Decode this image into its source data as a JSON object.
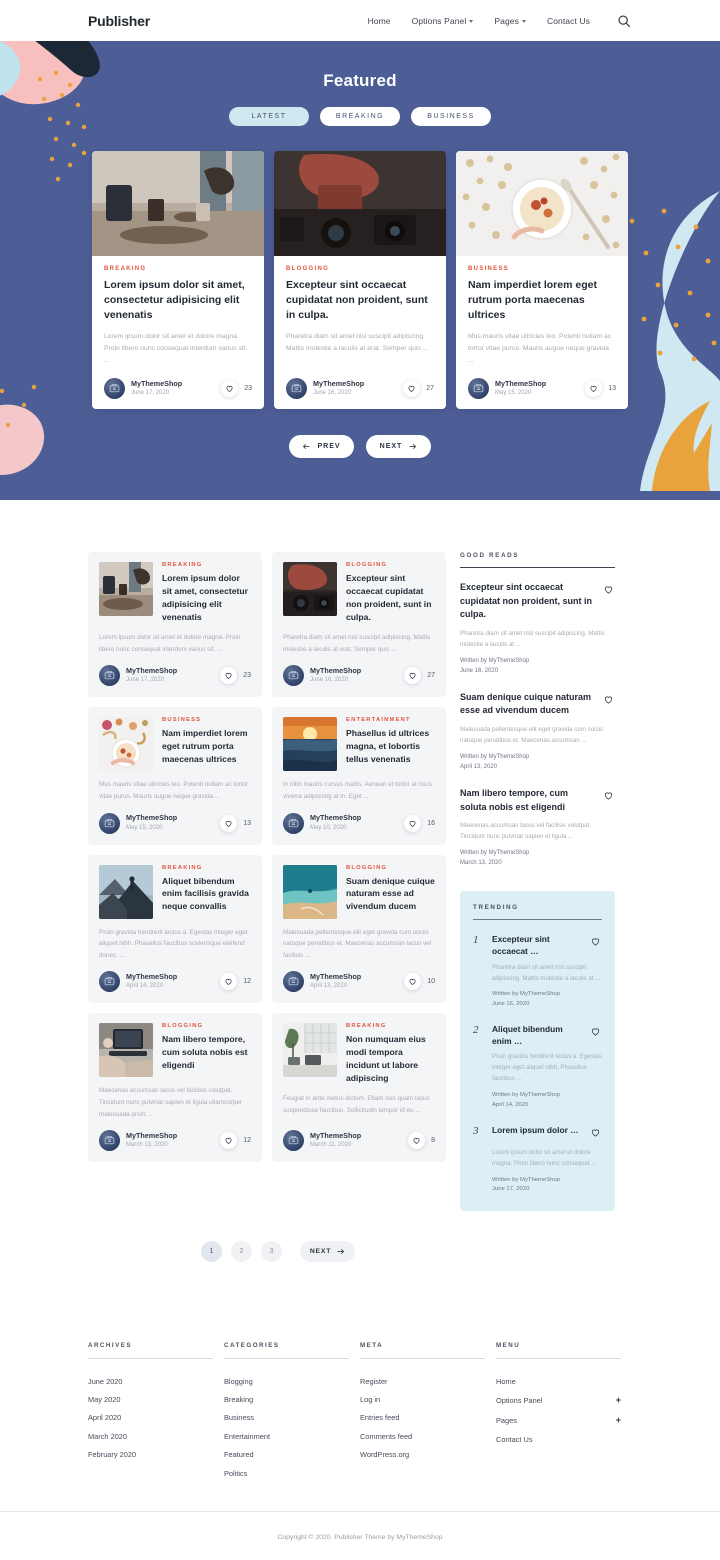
{
  "header": {
    "brand": "Publisher",
    "nav": [
      {
        "label": "Home",
        "caret": false
      },
      {
        "label": "Options Panel",
        "caret": true
      },
      {
        "label": "Pages",
        "caret": true
      },
      {
        "label": "Contact Us",
        "caret": false
      }
    ],
    "search_icon": "search-icon"
  },
  "hero": {
    "title": "Featured",
    "bg_color": "#4d5e96",
    "tabs": [
      {
        "label": "LATEST",
        "active": true
      },
      {
        "label": "BREAKING",
        "active": false
      },
      {
        "label": "BUSINESS",
        "active": false
      }
    ],
    "prev_label": "PREV",
    "next_label": "NEXT",
    "cards": [
      {
        "category": "BREAKING",
        "title": "Lorem ipsum dolor sit amet, consectetur adipisicing elit venenatis",
        "excerpt": "Lorem ipsum dolor sit amet et dolore magna. Proin libero nunc consequat interdum varius sit. ...",
        "author": "MyThemeShop",
        "date": "June 17, 2020",
        "likes": "23"
      },
      {
        "category": "BLOGGING",
        "title": "Excepteur sint occaecat cupidatat non proident, sunt in culpa.",
        "excerpt": "Pharetra diam sit amet nisl suscipit adipiscing. Mattis molestie a iaculis at erat. Semper quis ...",
        "author": "MyThemeShop",
        "date": "June 16, 2020",
        "likes": "27"
      },
      {
        "category": "BUSINESS",
        "title": "Nam imperdiet lorem eget rutrum porta maecenas ultrices",
        "excerpt": "Mus mauris vitae ultricies leo. Potenti nullam ac tortor vitae purus. Mauris augue neque gravida ...",
        "author": "MyThemeShop",
        "date": "May 15, 2020",
        "likes": "13"
      }
    ]
  },
  "posts": [
    {
      "category": "BREAKING",
      "title": "Lorem ipsum dolor sit amet, consectetur adipisicing elit venenatis",
      "excerpt": "Lorem ipsum dolor sit amet et dolore magna. Proin libero nunc consequat interdum varius sit. ...",
      "author": "MyThemeShop",
      "date": "June 17, 2020",
      "likes": "23"
    },
    {
      "category": "BLOGGING",
      "title": "Excepteur sint occaecat cupidatat non proident, sunt in culpa.",
      "excerpt": "Pharetra diam sit amet nisl suscipit adipiscing. Mattis molestie a iaculis at erat. Semper quis ...",
      "author": "MyThemeShop",
      "date": "June 16, 2020",
      "likes": "27"
    },
    {
      "category": "BUSINESS",
      "title": "Nam imperdiet lorem eget rutrum porta maecenas ultrices",
      "excerpt": "Mus mauris vitae ultricies leo. Potenti nullam ac tortor vitae purus. Mauris augue neque gravida ...",
      "author": "MyThemeShop",
      "date": "May 15, 2020",
      "likes": "13"
    },
    {
      "category": "ENTERTAINMENT",
      "title": "Phasellus id ultrices magna, et lobortis tellus venenatis",
      "excerpt": "In nibh mauris cursus mattis. Aenean et tortor at risus viverra adipiscing at in. Eget ...",
      "author": "MyThemeShop",
      "date": "May 10, 2020",
      "likes": "16"
    },
    {
      "category": "BREAKING",
      "title": "Aliquet bibendum enim facilisis gravida neque convallis",
      "excerpt": "Proin gravida hendrerit lectus a. Egestas integer eget aliquet nibh. Phasellus faucibus scelerisque eleifend donec. ...",
      "author": "MyThemeShop",
      "date": "April 14, 2020",
      "likes": "12"
    },
    {
      "category": "BLOGGING",
      "title": "Suam denique cuique naturam esse ad vivendum ducem",
      "excerpt": "Malesuada pellentesque elit eget gravida cum sociis natoque penatibus et. Maecenas accumsan lacus vel facilisis ...",
      "author": "MyThemeShop",
      "date": "April 13, 2020",
      "likes": "10"
    },
    {
      "category": "BLOGGING",
      "title": "Nam libero tempore, cum soluta nobis est eligendi",
      "excerpt": "Maecenas accumsan lacus vel facilisis volutpat. Tincidunt nunc pulvinar sapien et ligula ullamcorper malesuada proin. ...",
      "author": "MyThemeShop",
      "date": "March 13, 2020",
      "likes": "12"
    },
    {
      "category": "BREAKING",
      "title": "Non numquam eius modi tempora incidunt ut labore adipiscing",
      "excerpt": "Feugiat in ante metus dictum. Etiam non quam lacus suspendisse faucibus. Sollicitudin tempor id eu ...",
      "author": "MyThemeShop",
      "date": "March 11, 2020",
      "likes": "8"
    }
  ],
  "pagination": {
    "pages": [
      "1",
      "2",
      "3"
    ],
    "active": "1",
    "next_label": "NEXT"
  },
  "sidebar": {
    "good_reads": {
      "heading": "GOOD READS",
      "items": [
        {
          "title": "Excepteur sint occaecat cupidatat non proident, sunt in culpa.",
          "excerpt": "Pharetra diam sit amet nisl suscipit adipiscing. Mattis molestie a iaculis at ...",
          "written_by": "Written by MyThemeShop",
          "date": "June 16, 2020"
        },
        {
          "title": "Suam denique cuique naturam esse ad vivendum ducem",
          "excerpt": "Malesuada pellentesque elit eget gravida cum sociis natoque penatibus et. Maecenas accumsan ...",
          "written_by": "Written by MyThemeShop",
          "date": "April 13, 2020"
        },
        {
          "title": "Nam libero tempore, cum soluta nobis est eligendi",
          "excerpt": "Maecenas accumsan lacus vel facilisis volutpat. Tincidunt nunc pulvinar sapien et ligula ...",
          "written_by": "Written by MyThemeShop",
          "date": "March 13, 2020"
        }
      ]
    },
    "trending": {
      "heading": "TRENDING",
      "bg_color": "#ddeef5",
      "items": [
        {
          "rank": "1",
          "title": "Excepteur sint occaecat …",
          "excerpt": "Pharetra diam sit amet nisl suscipit adipiscing. Mattis molestie a iaculis at ...",
          "written_by": "Written by MyThemeShop",
          "date": "June 16, 2020"
        },
        {
          "rank": "2",
          "title": "Aliquet bibendum enim …",
          "excerpt": "Proin gravida hendrerit lectus a. Egestas integer eget aliquet nibh. Phasellus faucibus ...",
          "written_by": "Written by MyThemeShop",
          "date": "April 14, 2020"
        },
        {
          "rank": "3",
          "title": "Lorem ipsum dolor …",
          "excerpt": "Lorem ipsum dolor sit amet et dolore magna. Proin libero nunc consequat ...",
          "written_by": "Written by MyThemeShop",
          "date": "June 17, 2020"
        }
      ]
    }
  },
  "footer": {
    "columns": [
      {
        "heading": "ARCHIVES",
        "links": [
          {
            "label": "June 2020",
            "plus": false
          },
          {
            "label": "May 2020",
            "plus": false
          },
          {
            "label": "April 2020",
            "plus": false
          },
          {
            "label": "March 2020",
            "plus": false
          },
          {
            "label": "February 2020",
            "plus": false
          }
        ]
      },
      {
        "heading": "CATEGORIES",
        "links": [
          {
            "label": "Blogging",
            "plus": false
          },
          {
            "label": "Breaking",
            "plus": false
          },
          {
            "label": "Business",
            "plus": false
          },
          {
            "label": "Entertainment",
            "plus": false
          },
          {
            "label": "Featured",
            "plus": false
          },
          {
            "label": "Politics",
            "plus": false
          }
        ]
      },
      {
        "heading": "META",
        "links": [
          {
            "label": "Register",
            "plus": false
          },
          {
            "label": "Log in",
            "plus": false
          },
          {
            "label": "Entries feed",
            "plus": false
          },
          {
            "label": "Comments feed",
            "plus": false
          },
          {
            "label": "WordPress.org",
            "plus": false
          }
        ]
      },
      {
        "heading": "MENU",
        "links": [
          {
            "label": "Home",
            "plus": false
          },
          {
            "label": "Options Panel",
            "plus": true
          },
          {
            "label": "Pages",
            "plus": true
          },
          {
            "label": "Contact Us",
            "plus": false
          }
        ]
      }
    ],
    "copyright": "Copyright © 2020. Publisher Theme by MyThemeShop"
  }
}
